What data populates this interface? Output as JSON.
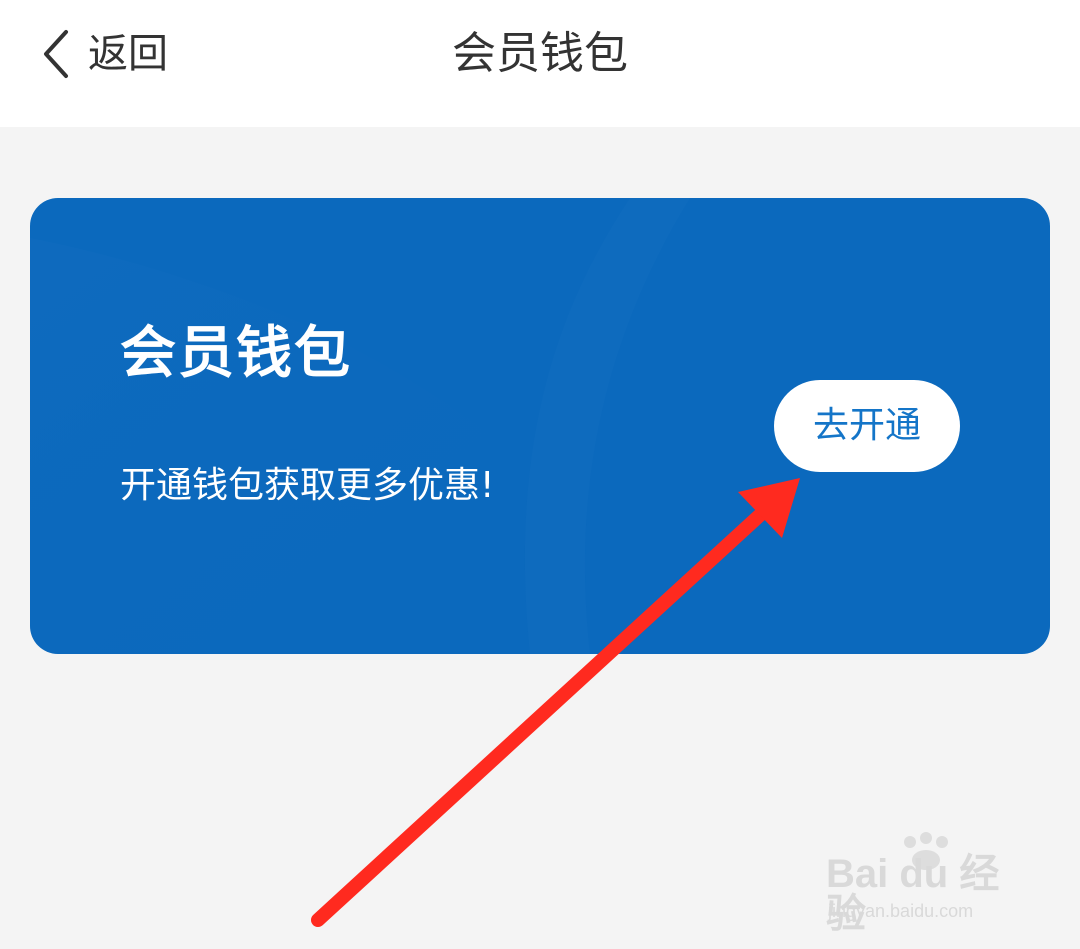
{
  "header": {
    "back_label": "返回",
    "title": "会员钱包"
  },
  "card": {
    "title": "会员钱包",
    "subtitle": "开通钱包获取更多优惠!",
    "button_label": "去开通"
  },
  "watermark": {
    "brand": "Bai du 经验",
    "url": "jingyan.baidu.com"
  },
  "colors": {
    "card_bg": "#0b69bd",
    "button_text": "#1475c8",
    "arrow": "#ff2a1f",
    "page_bg": "#f4f4f4"
  },
  "icons": {
    "back": "chevron-left-icon",
    "annotation": "red-arrow-icon",
    "watermark_logo": "baidu-paw-icon"
  }
}
